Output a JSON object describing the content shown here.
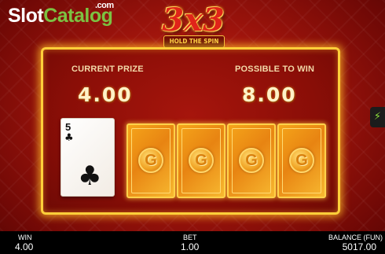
{
  "watermark": {
    "brand_part1": "Slot",
    "brand_part2": "Catalog",
    "brand_suffix": ".com"
  },
  "game_logo": {
    "title": "3x3",
    "subtitle": "HOLD THE SPIN"
  },
  "prize_panel": {
    "current_prize_label": "CURRENT PRIZE",
    "current_prize_value": "4.00",
    "possible_win_label": "POSSIBLE TO WIN",
    "possible_win_value": "8.00"
  },
  "cards": {
    "revealed": {
      "rank": "5",
      "suit": "♣"
    },
    "face_down": [
      {
        "mark": "G"
      },
      {
        "mark": "G"
      },
      {
        "mark": "G"
      },
      {
        "mark": "G"
      }
    ]
  },
  "side_tab": {
    "icon": "lightning-icon",
    "glyph": "⚡"
  },
  "status_bar": {
    "win_label": "WIN",
    "win_value": "4.00",
    "bet_label": "BET",
    "bet_value": "1.00",
    "balance_label": "BALANCE (FUN)",
    "balance_value": "5017.00"
  },
  "colors": {
    "background": "#9e140c",
    "panel_border": "#ffcf3a",
    "card_back": "#f5a51a",
    "watermark_green": "#7cc242"
  }
}
